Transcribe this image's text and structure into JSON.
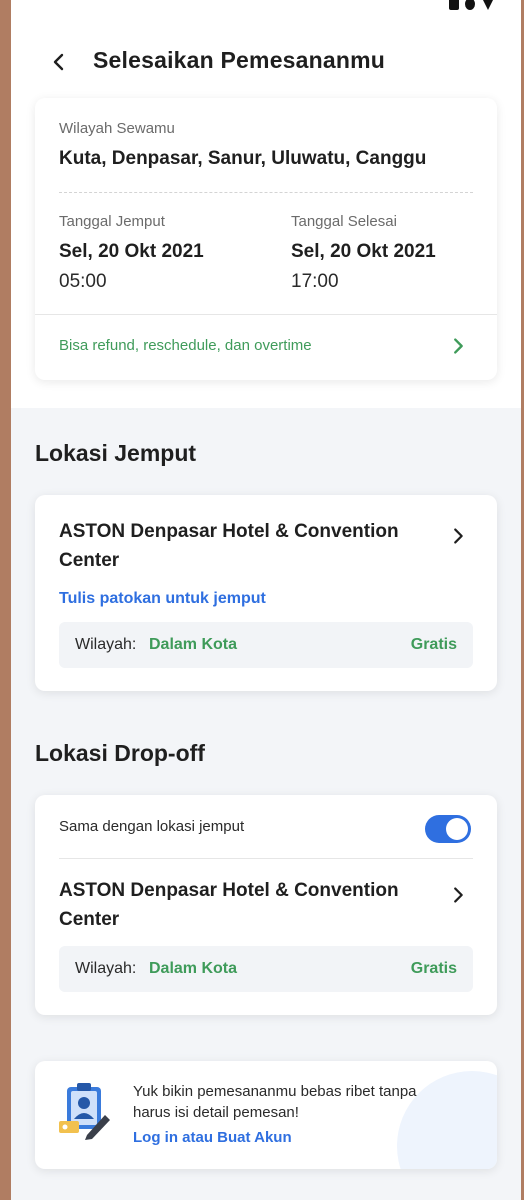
{
  "header": {
    "title": "Selesaikan Pemesananmu"
  },
  "summary": {
    "region_label": "Wilayah Sewamu",
    "region_value": "Kuta, Denpasar, Sanur, Uluwatu, Canggu",
    "pickup_label": "Tanggal Jemput",
    "pickup_date": "Sel, 20 Okt 2021",
    "pickup_time": "05:00",
    "end_label": "Tanggal Selesai",
    "end_date": "Sel, 20 Okt 2021",
    "end_time": "17:00",
    "policy_text": "Bisa refund, reschedule, dan overtime"
  },
  "pickup": {
    "section_title": "Lokasi Jemput",
    "location_name": "ASTON Denpasar Hotel & Convention Center",
    "landmark_link": "Tulis patokan untuk jemput",
    "region_label": "Wilayah:",
    "region_value": "Dalam Kota",
    "price": "Gratis"
  },
  "dropoff": {
    "section_title": "Lokasi Drop-off",
    "same_label": "Sama dengan lokasi jemput",
    "same_enabled": true,
    "location_name": "ASTON Denpasar Hotel & Convention Center",
    "region_label": "Wilayah:",
    "region_value": "Dalam Kota",
    "price": "Gratis"
  },
  "login_banner": {
    "text": "Yuk bikin pemesananmu bebas ribet tanpa harus isi detail pemesan!",
    "link": "Log in atau Buat Akun"
  },
  "icons": {
    "back": "chevron-left-icon",
    "policy_arrow": "chevron-right-icon",
    "location_arrow": "chevron-right-icon",
    "login": "user-badge-icon"
  },
  "colors": {
    "green": "#3f9b5a",
    "blue": "#2f6fe0",
    "background": "#f3f5f8"
  }
}
